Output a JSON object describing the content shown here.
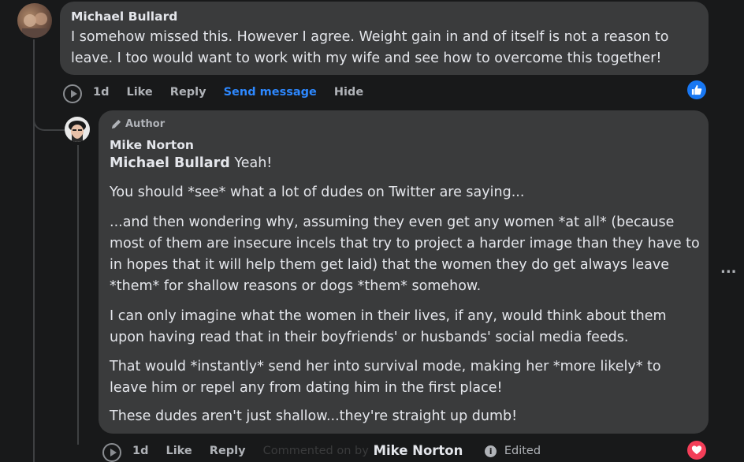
{
  "comment1": {
    "author": "Michael Bullard",
    "text": "I somehow missed this. However I agree. Weight gain in and of itself is not a reason to leave. I too would want to work with my wife and see how to overcome this together!",
    "actions": {
      "time": "1d",
      "like": "Like",
      "reply": "Reply",
      "send_message": "Send message",
      "hide": "Hide"
    },
    "reaction": "like-icon"
  },
  "reply1": {
    "badge": "Author",
    "author": "Mike Norton",
    "mention": "Michael Bullard",
    "first_line": " Yeah!",
    "paragraphs": [
      "You should *see* what a lot of dudes on Twitter are saying...",
      "...and then wondering why, assuming they even get any women *at all* (because most of them are insecure incels that try to project a harder image than they have to in hopes that it will help them get laid) that the women they do get always leave *them* for shallow reasons or dogs *them* somehow.",
      "I can only imagine what the women in their lives, if any, would think about them upon having read that in their boyfriends' or husbands' social media feeds.",
      "That would *instantly* send her into survival mode, making her *more likely* to leave him or repel any from dating him in the first place!",
      "These dudes aren't just shallow...they're straight up dumb!"
    ],
    "actions": {
      "time": "1d",
      "like": "Like",
      "reply": "Reply",
      "commented_by": "Commented on by",
      "author_name": "Mike Norton",
      "edited": "Edited"
    },
    "reaction": "heart-icon"
  },
  "more_options": "...",
  "colors": {
    "background": "#18191a",
    "bubble": "#3a3b3c",
    "link": "#2d88ff",
    "like": "#1877f2",
    "love": "#f33e58"
  }
}
